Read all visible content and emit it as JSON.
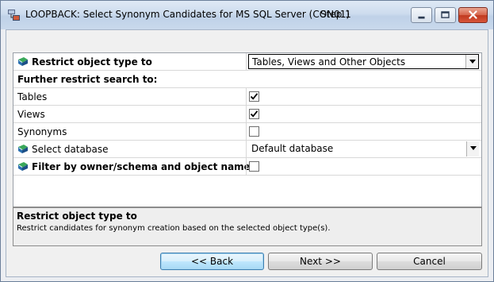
{
  "window": {
    "title": "LOOPBACK: Select Synonym Candidates for MS SQL Server (CON01)",
    "step": "Step 1",
    "icon": "database-app-icon"
  },
  "grid": {
    "restrict_type": {
      "label": "Restrict object type to",
      "value": "Tables, Views and Other Objects"
    },
    "further_header": "Further restrict search to:",
    "tables": {
      "label": "Tables",
      "checked": true
    },
    "views": {
      "label": "Views",
      "checked": true
    },
    "synonyms": {
      "label": "Synonyms",
      "checked": false
    },
    "select_db": {
      "label": "Select database",
      "value": "Default database"
    },
    "filter_owner": {
      "label": "Filter by owner/schema and object name",
      "checked": false
    }
  },
  "description": {
    "title": "Restrict object type to",
    "text": "Restrict candidates for synonym creation based on the selected object type(s)."
  },
  "buttons": {
    "back": "<< Back",
    "next": "Next >>",
    "cancel": "Cancel"
  }
}
